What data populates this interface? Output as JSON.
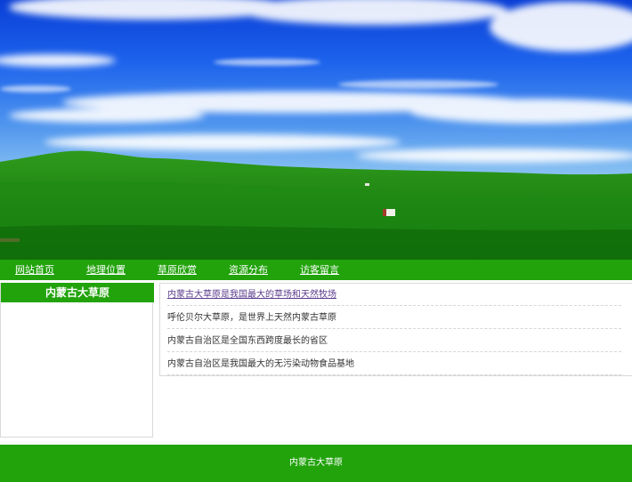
{
  "nav": {
    "items": [
      {
        "label": "网站首页"
      },
      {
        "label": "地理位置"
      },
      {
        "label": "草原欣赏"
      },
      {
        "label": "资源分布"
      },
      {
        "label": "访客留言"
      }
    ]
  },
  "sidebar": {
    "title": "内蒙古大草原"
  },
  "list": {
    "items": [
      {
        "text": "内蒙古大草原是我国最大的草场和天然牧场"
      },
      {
        "text": "呼伦贝尔大草原，是世界上天然内蒙古草原"
      },
      {
        "text": "内蒙古自治区是全国东西跨度最长的省区"
      },
      {
        "text": "内蒙古自治区是我国最大的无污染动物食品基地"
      }
    ]
  },
  "footer": {
    "text": "内蒙古大草原"
  },
  "colors": {
    "brand_green": "#22a30c",
    "sky_blue": "#1a4fe0",
    "link_purple": "#5a3b8c"
  }
}
